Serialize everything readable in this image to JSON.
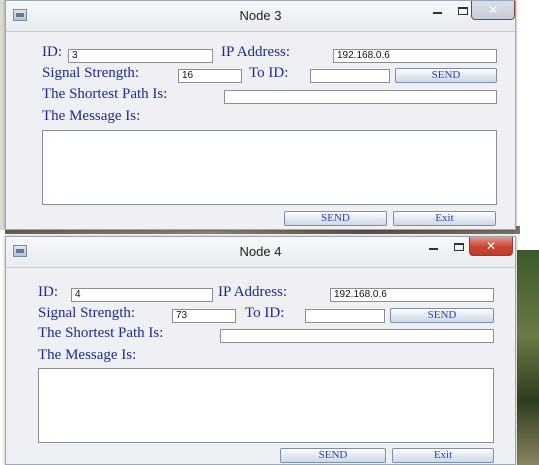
{
  "windows": [
    {
      "title": "Node 3",
      "id_label": "ID:",
      "id_value": "3",
      "ip_label": "IP Address:",
      "ip_value": "192.168.0.6",
      "signal_label": "Signal Strength:",
      "signal_value": "16",
      "to_id_label": "To ID:",
      "to_id_value": "",
      "send_top_label": "SEND",
      "path_label": "The Shortest Path Is:",
      "path_value": "",
      "message_label": "The Message Is:",
      "message_value": "",
      "send_label": "SEND",
      "exit_label": "Exit",
      "active": false
    },
    {
      "title": "Node 4",
      "id_label": "ID:",
      "id_value": "4",
      "ip_label": "IP Address:",
      "ip_value": "192.168.0.6",
      "signal_label": "Signal Strength:",
      "signal_value": "73",
      "to_id_label": "To ID:",
      "to_id_value": "",
      "send_top_label": "SEND",
      "path_label": "The Shortest Path Is:",
      "path_value": "",
      "message_label": "The Message Is:",
      "message_value": "",
      "send_label": "SEND",
      "exit_label": "Exit",
      "active": true
    }
  ],
  "controls": {
    "minimize_icon": "minimize-icon",
    "maximize_icon": "maximize-icon",
    "close_icon": "close-icon",
    "close_glyph": "✕"
  },
  "colors": {
    "label_text": "#1c2b8f",
    "window_bg": "#eef0f3",
    "close_active": "#c74536"
  }
}
